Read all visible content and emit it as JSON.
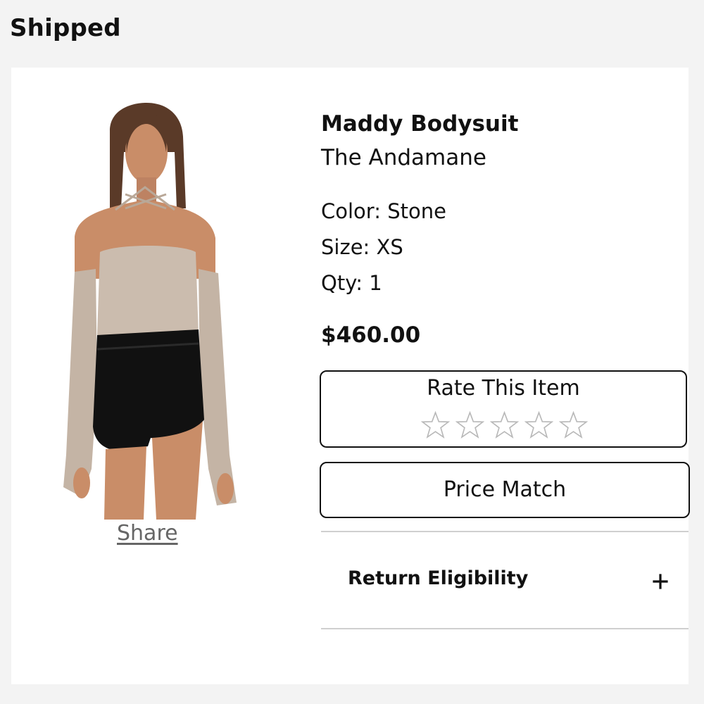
{
  "header": {
    "title": "Shipped"
  },
  "product": {
    "image_alt": "Model wearing stone off-shoulder bodysuit with black shorts",
    "share_label": "Share",
    "name": "Maddy Bodysuit",
    "brand": "The Andamane",
    "color": "Color: Stone",
    "size": "Size: XS",
    "qty": "Qty: 1",
    "price": "$460.00"
  },
  "rating": {
    "title": "Rate This Item",
    "stars": 5,
    "icon": "star-outline-icon"
  },
  "actions": {
    "price_match_label": "Price Match"
  },
  "return_section": {
    "label": "Return Eligibility",
    "icon": "plus-icon"
  },
  "colors": {
    "background": "#f3f3f3",
    "card": "#ffffff",
    "text": "#111111",
    "share_link": "#666666",
    "divider": "#cfcfcf",
    "star_stroke": "#b8b8b8",
    "bodysuit": "#cbbcae",
    "shorts": "#111111",
    "skin": "#c98d68",
    "hair": "#5a3a28"
  }
}
